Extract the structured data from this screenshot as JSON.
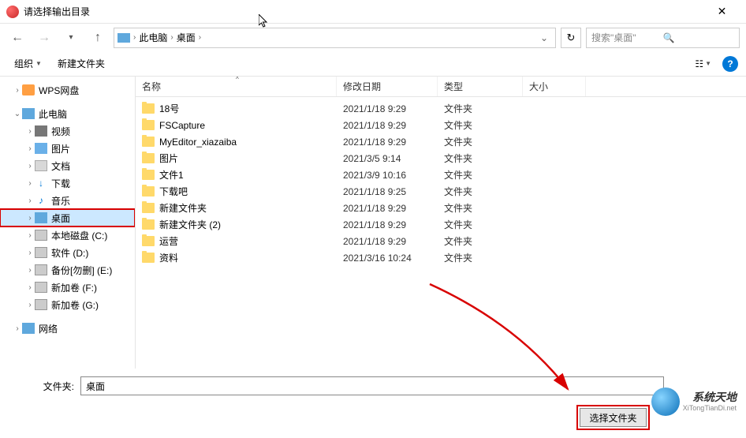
{
  "title": "请选择输出目录",
  "breadcrumb": {
    "root": "此电脑",
    "folder": "桌面"
  },
  "search": {
    "placeholder": "搜索\"桌面\""
  },
  "toolbar": {
    "organize": "组织",
    "newfolder": "新建文件夹"
  },
  "columns": {
    "name": "名称",
    "date": "修改日期",
    "type": "类型",
    "size": "大小"
  },
  "sidebar": {
    "wps": "WPS网盘",
    "pc": "此电脑",
    "video": "视频",
    "pictures": "图片",
    "documents": "文档",
    "downloads": "下载",
    "music": "音乐",
    "desktop": "桌面",
    "drive_c": "本地磁盘 (C:)",
    "drive_d": "软件 (D:)",
    "drive_e": "备份[勿删] (E:)",
    "drive_f": "新加卷 (F:)",
    "drive_g": "新加卷 (G:)",
    "network": "网络"
  },
  "files": [
    {
      "name": "18号",
      "date": "2021/1/18 9:29",
      "type": "文件夹"
    },
    {
      "name": "FSCapture",
      "date": "2021/1/18 9:29",
      "type": "文件夹"
    },
    {
      "name": "MyEditor_xiazaiba",
      "date": "2021/1/18 9:29",
      "type": "文件夹"
    },
    {
      "name": "图片",
      "date": "2021/3/5 9:14",
      "type": "文件夹"
    },
    {
      "name": "文件1",
      "date": "2021/3/9 10:16",
      "type": "文件夹"
    },
    {
      "name": "下载吧",
      "date": "2021/1/18 9:25",
      "type": "文件夹"
    },
    {
      "name": "新建文件夹",
      "date": "2021/1/18 9:29",
      "type": "文件夹"
    },
    {
      "name": "新建文件夹 (2)",
      "date": "2021/1/18 9:29",
      "type": "文件夹"
    },
    {
      "name": "运营",
      "date": "2021/1/18 9:29",
      "type": "文件夹"
    },
    {
      "name": "资料",
      "date": "2021/3/16 10:24",
      "type": "文件夹"
    }
  ],
  "footer": {
    "label": "文件夹:",
    "value": "桌面",
    "select_btn": "选择文件夹"
  },
  "watermark": {
    "line1": "系统天地",
    "line2": "XiTongTianDi.net"
  }
}
